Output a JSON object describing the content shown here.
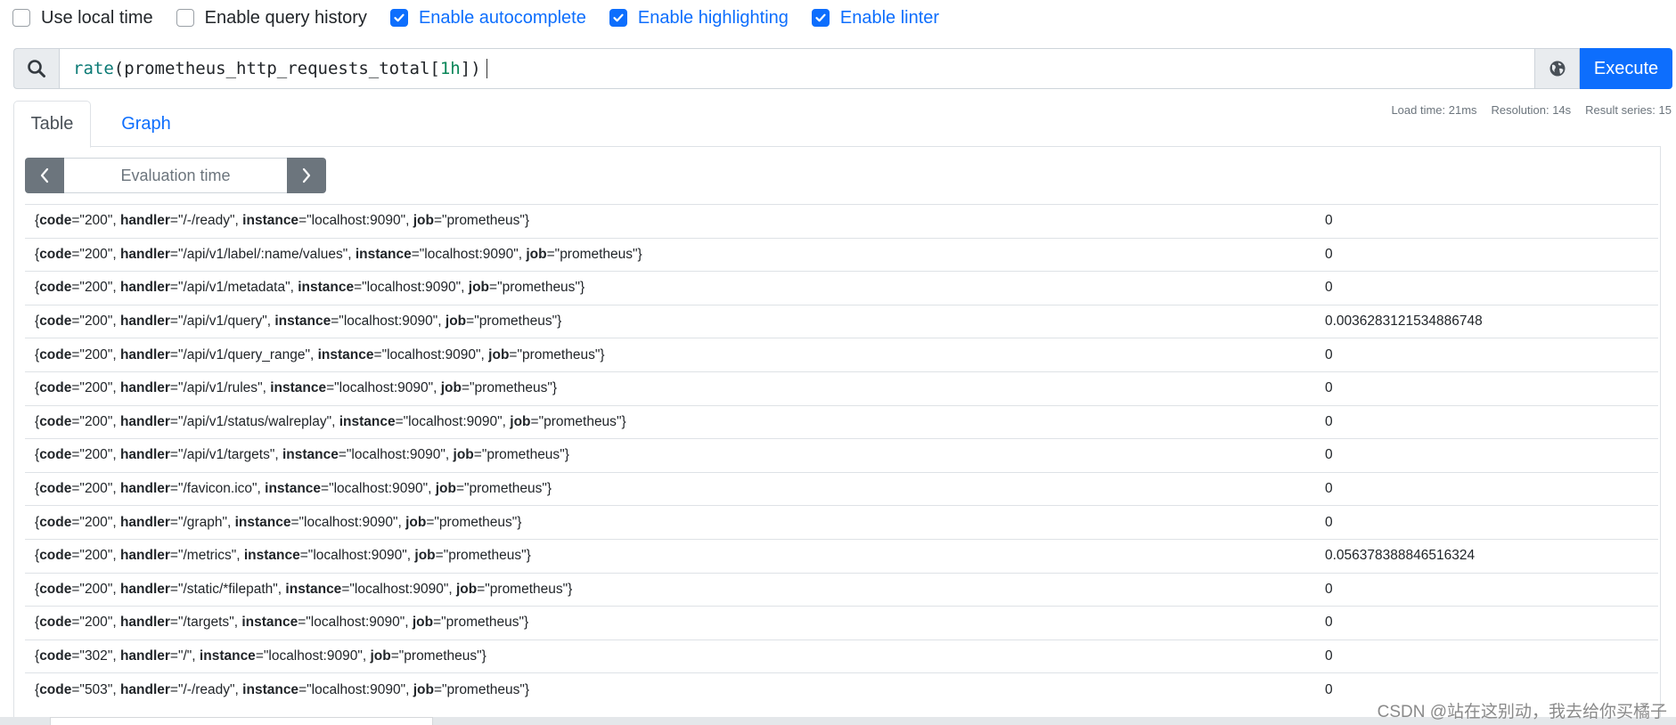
{
  "options": [
    {
      "label": "Use local time",
      "checked": false
    },
    {
      "label": "Enable query history",
      "checked": false
    },
    {
      "label": "Enable autocomplete",
      "checked": true
    },
    {
      "label": "Enable highlighting",
      "checked": true
    },
    {
      "label": "Enable linter",
      "checked": true
    }
  ],
  "query": {
    "fn": "rate",
    "open": "(",
    "metric": "prometheus_http_requests_total",
    "range_open": "[",
    "range": "1h",
    "range_close": "]",
    "close": ")"
  },
  "execute_label": "Execute",
  "stats": {
    "load_time": "Load time: 21ms",
    "resolution": "Resolution: 14s",
    "result_series": "Result series: 15"
  },
  "tabs": {
    "table": "Table",
    "graph": "Graph"
  },
  "eval_placeholder": "Evaluation time",
  "rows": [
    {
      "code": "200",
      "handler": "/-/ready",
      "instance": "localhost:9090",
      "job": "prometheus",
      "value": "0"
    },
    {
      "code": "200",
      "handler": "/api/v1/label/:name/values",
      "instance": "localhost:9090",
      "job": "prometheus",
      "value": "0"
    },
    {
      "code": "200",
      "handler": "/api/v1/metadata",
      "instance": "localhost:9090",
      "job": "prometheus",
      "value": "0"
    },
    {
      "code": "200",
      "handler": "/api/v1/query",
      "instance": "localhost:9090",
      "job": "prometheus",
      "value": "0.0036283121534886748"
    },
    {
      "code": "200",
      "handler": "/api/v1/query_range",
      "instance": "localhost:9090",
      "job": "prometheus",
      "value": "0"
    },
    {
      "code": "200",
      "handler": "/api/v1/rules",
      "instance": "localhost:9090",
      "job": "prometheus",
      "value": "0"
    },
    {
      "code": "200",
      "handler": "/api/v1/status/walreplay",
      "instance": "localhost:9090",
      "job": "prometheus",
      "value": "0"
    },
    {
      "code": "200",
      "handler": "/api/v1/targets",
      "instance": "localhost:9090",
      "job": "prometheus",
      "value": "0"
    },
    {
      "code": "200",
      "handler": "/favicon.ico",
      "instance": "localhost:9090",
      "job": "prometheus",
      "value": "0"
    },
    {
      "code": "200",
      "handler": "/graph",
      "instance": "localhost:9090",
      "job": "prometheus",
      "value": "0"
    },
    {
      "code": "200",
      "handler": "/metrics",
      "instance": "localhost:9090",
      "job": "prometheus",
      "value": "0.056378388846516324"
    },
    {
      "code": "200",
      "handler": "/static/*filepath",
      "instance": "localhost:9090",
      "job": "prometheus",
      "value": "0"
    },
    {
      "code": "200",
      "handler": "/targets",
      "instance": "localhost:9090",
      "job": "prometheus",
      "value": "0"
    },
    {
      "code": "302",
      "handler": "/",
      "instance": "localhost:9090",
      "job": "prometheus",
      "value": "0"
    },
    {
      "code": "503",
      "handler": "/-/ready",
      "instance": "localhost:9090",
      "job": "prometheus",
      "value": "0"
    }
  ],
  "watermark": "CSDN @站在这别动，我去给你买橘子"
}
